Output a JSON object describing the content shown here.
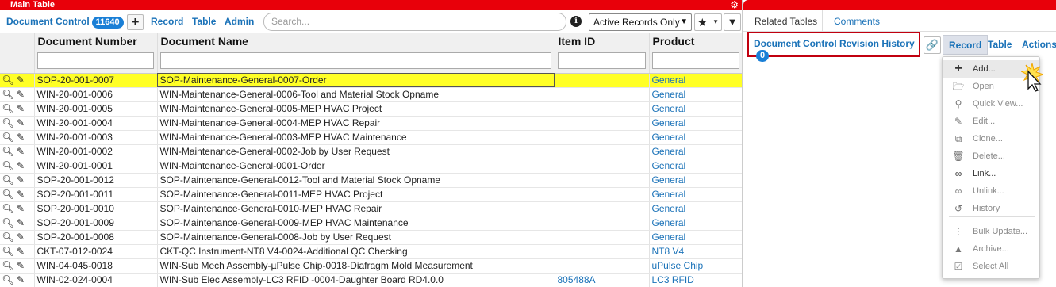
{
  "main": {
    "title": "Main Table",
    "table_name": "Document Control",
    "record_count": "11640",
    "toolbar": {
      "record": "Record",
      "table": "Table",
      "admin": "Admin",
      "search_placeholder": "Search...",
      "filter_select": "Active Records Only"
    },
    "columns": [
      "Document Number",
      "Document Name",
      "Item ID",
      "Product"
    ],
    "rows": [
      {
        "number": "SOP-20-001-0007",
        "name": "SOP-Maintenance-General-0007-Order",
        "item_id": "",
        "product": "General"
      },
      {
        "number": "WIN-20-001-0006",
        "name": "WIN-Maintenance-General-0006-Tool and Material Stock Opname",
        "item_id": "",
        "product": "General"
      },
      {
        "number": "WIN-20-001-0005",
        "name": "WIN-Maintenance-General-0005-MEP HVAC Project",
        "item_id": "",
        "product": "General"
      },
      {
        "number": "WIN-20-001-0004",
        "name": "WIN-Maintenance-General-0004-MEP HVAC Repair",
        "item_id": "",
        "product": "General"
      },
      {
        "number": "WIN-20-001-0003",
        "name": "WIN-Maintenance-General-0003-MEP HVAC Maintenance",
        "item_id": "",
        "product": "General"
      },
      {
        "number": "WIN-20-001-0002",
        "name": "WIN-Maintenance-General-0002-Job by User Request",
        "item_id": "",
        "product": "General"
      },
      {
        "number": "WIN-20-001-0001",
        "name": "WIN-Maintenance-General-0001-Order",
        "item_id": "",
        "product": "General"
      },
      {
        "number": "SOP-20-001-0012",
        "name": "SOP-Maintenance-General-0012-Tool and Material Stock Opname",
        "item_id": "",
        "product": "General"
      },
      {
        "number": "SOP-20-001-0011",
        "name": "SOP-Maintenance-General-0011-MEP HVAC Project",
        "item_id": "",
        "product": "General"
      },
      {
        "number": "SOP-20-001-0010",
        "name": "SOP-Maintenance-General-0010-MEP HVAC Repair",
        "item_id": "",
        "product": "General"
      },
      {
        "number": "SOP-20-001-0009",
        "name": "SOP-Maintenance-General-0009-MEP HVAC Maintenance",
        "item_id": "",
        "product": "General"
      },
      {
        "number": "SOP-20-001-0008",
        "name": "SOP-Maintenance-General-0008-Job by User Request",
        "item_id": "",
        "product": "General"
      },
      {
        "number": "CKT-07-012-0024",
        "name": "CKT-QC Instrument-NT8 V4-0024-Additional QC Checking",
        "item_id": "",
        "product": "NT8 V4"
      },
      {
        "number": "WIN-04-045-0018",
        "name": "WIN-Sub Mech Assembly-µPulse Chip-0018-Diafragm Mold Measurement",
        "item_id": "",
        "product": "uPulse Chip"
      },
      {
        "number": "WIN-02-024-0004",
        "name": "WIN-Sub Elec Assembly-LC3 RFID -0004-Daughter Board RD4.0.0",
        "item_id": "805488A",
        "product": "LC3 RFID"
      }
    ]
  },
  "related": {
    "tabs": [
      "Related Tables",
      "Comments"
    ],
    "revision_history_label": "Document Control Revision History",
    "revision_count": "0",
    "menu_tabs": [
      "Record",
      "Table",
      "Actions"
    ],
    "record_menu": [
      {
        "label": "Add...",
        "icon": "plus-icon",
        "enabled": true
      },
      {
        "label": "Open",
        "icon": "folder-open-icon",
        "enabled": false
      },
      {
        "label": "Quick View...",
        "icon": "search-icon",
        "enabled": false
      },
      {
        "label": "Edit...",
        "icon": "pencil-icon",
        "enabled": false
      },
      {
        "label": "Clone...",
        "icon": "clone-icon",
        "enabled": false
      },
      {
        "label": "Delete...",
        "icon": "trash-icon",
        "enabled": false
      },
      {
        "label": "Link...",
        "icon": "link-icon",
        "enabled": true
      },
      {
        "label": "Unlink...",
        "icon": "unlink-icon",
        "enabled": false
      },
      {
        "label": "History",
        "icon": "history-icon",
        "enabled": false
      },
      {
        "label": "Bulk Update...",
        "icon": "bulk-update-icon",
        "enabled": false
      },
      {
        "label": "Archive...",
        "icon": "archive-icon",
        "enabled": false
      },
      {
        "label": "Select All",
        "icon": "checkbox-icon",
        "enabled": false
      }
    ]
  },
  "colors": {
    "title_bar": "#e8000a",
    "link_blue": "#1a72b8",
    "badge_blue": "#1a7fd6",
    "selected_row": "#ffff26",
    "highlight_box": "#c1000f"
  }
}
